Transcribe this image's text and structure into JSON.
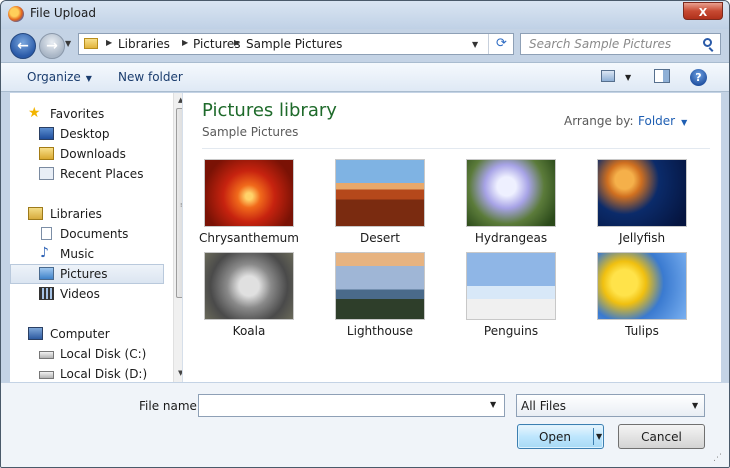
{
  "window": {
    "title": "File Upload",
    "close_glyph": "X"
  },
  "navigation": {
    "back_glyph": "←",
    "forward_glyph": "→",
    "breadcrumbs": [
      "Libraries",
      "Pictures",
      "Sample Pictures"
    ],
    "search_placeholder": "Search Sample Pictures"
  },
  "toolbar": {
    "organize": "Organize",
    "new_folder": "New folder",
    "help_glyph": "?"
  },
  "sidebar": {
    "favorites": {
      "label": "Favorites",
      "items": [
        "Desktop",
        "Downloads",
        "Recent Places"
      ]
    },
    "libraries": {
      "label": "Libraries",
      "items": [
        "Documents",
        "Music",
        "Pictures",
        "Videos"
      ],
      "selected": "Pictures"
    },
    "computer": {
      "label": "Computer",
      "items": [
        "Local Disk (C:)",
        "Local Disk (D:)"
      ]
    }
  },
  "content": {
    "title": "Pictures library",
    "subtitle": "Sample Pictures",
    "arrange_label": "Arrange by:",
    "arrange_value": "Folder",
    "files": [
      "Chrysanthemum",
      "Desert",
      "Hydrangeas",
      "Jellyfish",
      "Koala",
      "Lighthouse",
      "Penguins",
      "Tulips"
    ]
  },
  "footer": {
    "file_name_label": "File name:",
    "file_name_value": "",
    "file_type": "All Files",
    "open_label": "Open",
    "cancel_label": "Cancel"
  },
  "colors": {
    "library_title": "#1e6a2a",
    "link_blue": "#1f5fb3",
    "selection": "#dbe5f1"
  }
}
